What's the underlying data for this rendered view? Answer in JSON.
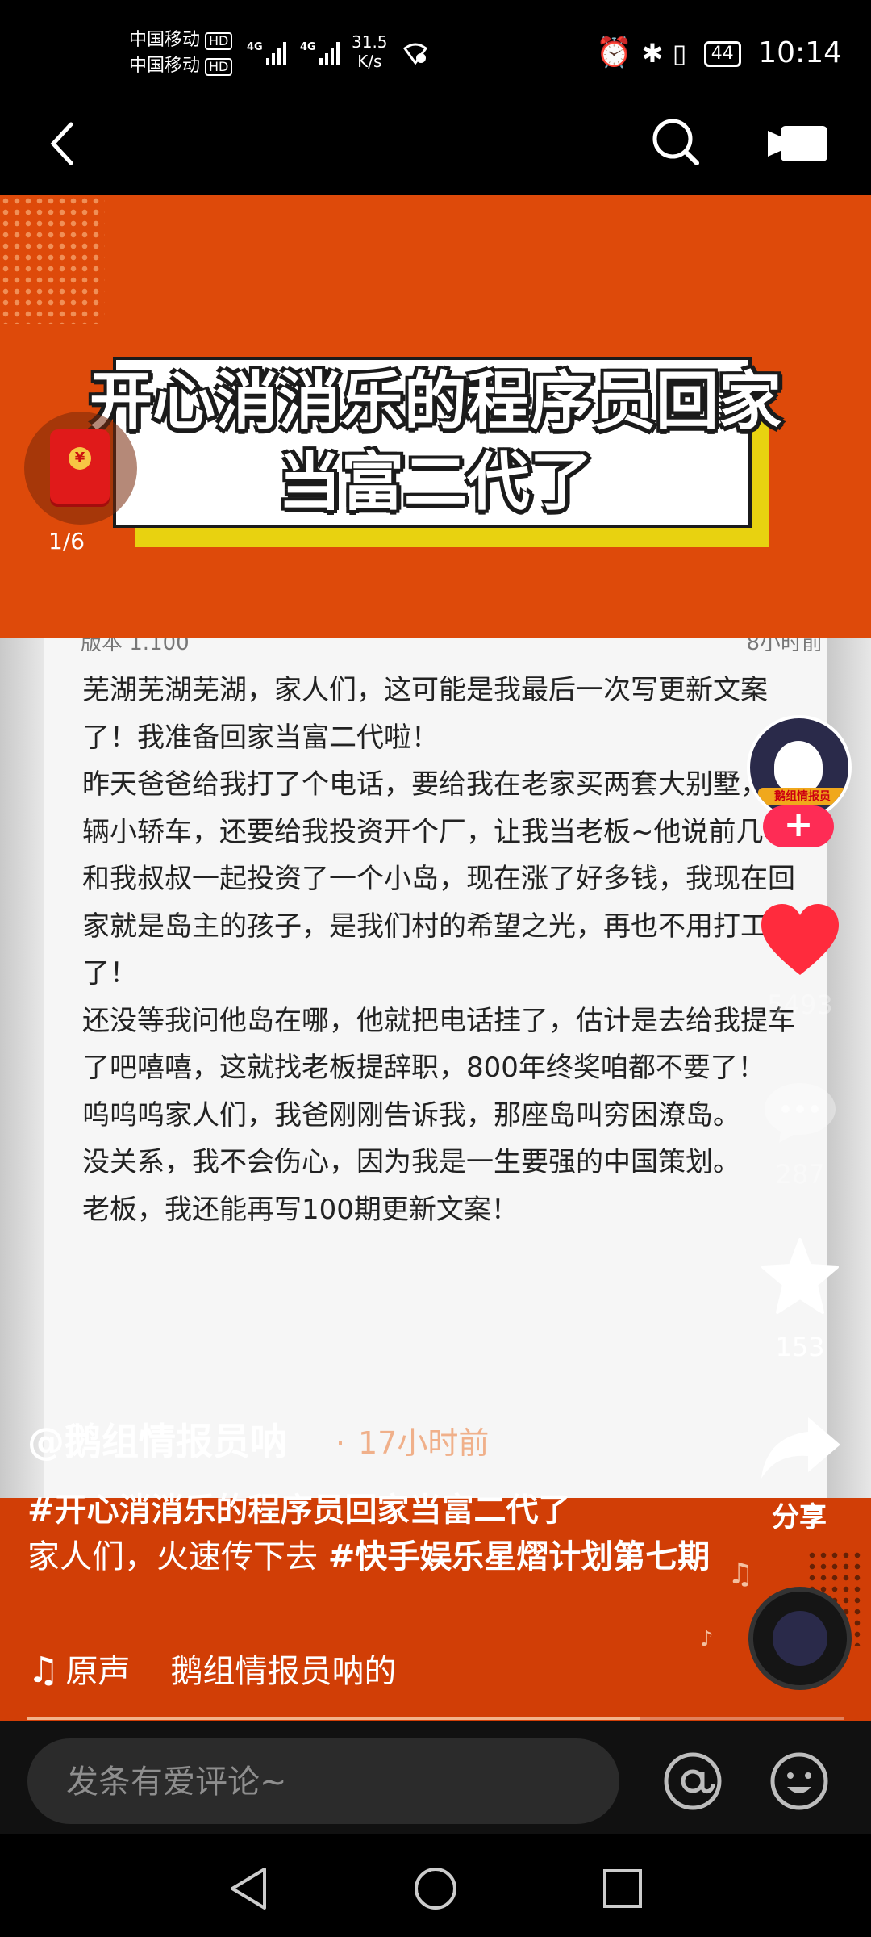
{
  "status_bar": {
    "carrier1": "中国移动",
    "carrier2": "中国移动",
    "hd": "HD",
    "net1": "4G",
    "net2": "4G",
    "speed_value": "31.5",
    "speed_unit": "K/s",
    "battery": "44",
    "time": "10:14"
  },
  "video": {
    "headline_line1": "开心消消乐的程序员回家",
    "headline_line2": "当富二代了",
    "doc_head_left": "版本 1.100",
    "doc_head_right": "8小时前",
    "paragraphs": [
      "芜湖芜湖芜湖，家人们，这可能是我最后一次写更新文案了！我准备回家当富二代啦！",
      "昨天爸爸给我打了个电话，要给我在老家买两套大别墅，三辆小轿车，还要给我投资开个厂，让我当老板~他说前几年和我叔叔一起投资了一个小岛，现在涨了好多钱，我现在回家就是岛主的孩子，是我们村的希望之光，再也不用打工了！",
      "还没等我问他岛在哪，他就把电话挂了，估计是去给我提车了吧嘻嘻，这就找老板提辞职，800年终奖咱都不要了！",
      "呜呜呜家人们，我爸刚刚告诉我，那座岛叫穷困潦岛。",
      "没关系，我不会伤心，因为我是一生要强的中国策划。",
      "老板，我还能再写100期更新文案！"
    ]
  },
  "red_packet": {
    "count": "1/6"
  },
  "rail": {
    "avatar_label": "鹅组情报员",
    "follow": "+",
    "likes": "5493",
    "comments": "287",
    "favorites": "153",
    "share": "分享"
  },
  "caption": {
    "author": "@鹅组情报员呐",
    "separator": "·",
    "time": "17小时前",
    "tag1": "#开心消消乐的程序员回家当富二代了",
    "desc_text": "家人们，火速传下去 ",
    "tag2": "#快手娱乐星熠计划第七期",
    "music_prefix": "原声",
    "music_author": "鹅组情报员呐的"
  },
  "progress": 0.75,
  "comment_bar": {
    "placeholder": "发条有爱评论~"
  },
  "colors": {
    "accent": "#fe2c55",
    "video_bg": "#d34307"
  }
}
